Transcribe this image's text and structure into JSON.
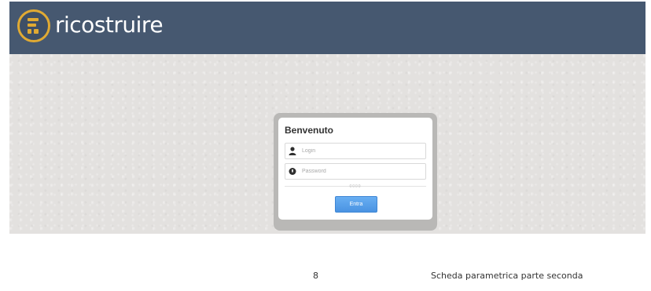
{
  "header": {
    "brand_name": "ricostruire",
    "logo_icon": "ricostruire-logo-icon",
    "background_color": "#465870",
    "logo_accent_color": "#e0aa33"
  },
  "login": {
    "title": "Benvenuto",
    "login_field": {
      "placeholder": "Login",
      "value": "",
      "icon": "user-icon"
    },
    "password_field": {
      "placeholder": "Password",
      "value": "",
      "icon": "lock-icon"
    },
    "captcha_text": "0000",
    "submit_label": "Entra",
    "submit_color": "#4a93e2"
  },
  "footer": {
    "page_number": "8",
    "document_title": "Scheda parametrica parte seconda"
  }
}
